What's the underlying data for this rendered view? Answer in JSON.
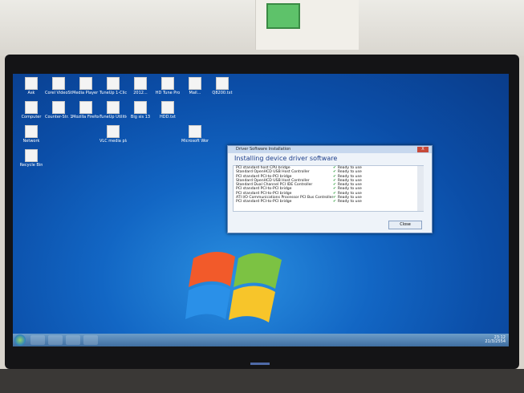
{
  "dialog": {
    "window_title": "Driver Software Installation",
    "close_glyph": "X",
    "heading": "Installing device driver software",
    "close_button": "Close",
    "rows": [
      {
        "device": "PCI standard host CPU bridge",
        "status": "Ready to use"
      },
      {
        "device": "Standard OpenHCD USB Host Controller",
        "status": "Ready to use"
      },
      {
        "device": "PCI standard PCI-to-PCI bridge",
        "status": "Ready to use"
      },
      {
        "device": "Standard OpenHCD USB Host Controller",
        "status": "Ready to use"
      },
      {
        "device": "Standard Dual Channel PCI IDE Controller",
        "status": "Ready to use"
      },
      {
        "device": "PCI standard PCI-to-PCI bridge",
        "status": "Ready to use"
      },
      {
        "device": "PCI standard PCI-to-PCI bridge",
        "status": "Ready to use"
      },
      {
        "device": "ATI I/O Communications Processor PCI Bus Controller",
        "status": "Ready to use"
      },
      {
        "device": "PCI standard PCI-to-PCI bridge",
        "status": "Ready to use"
      }
    ]
  },
  "desktop_icons": [
    {
      "label": "Ask"
    },
    {
      "label": "Corel VideoStudi..."
    },
    {
      "label": "Media Player Classic"
    },
    {
      "label": "TuneUp 1-Click Mai..."
    },
    {
      "label": "2012..."
    },
    {
      "label": "HD Tune Pro"
    },
    {
      "label": "Mail..."
    },
    {
      "label": "Q8200.txt"
    },
    {
      "label": "Computer"
    },
    {
      "label": "Counter-Str. 1.6"
    },
    {
      "label": "Mozilla Firefox"
    },
    {
      "label": "TuneUp Utilities"
    },
    {
      "label": "Big sis 13"
    },
    {
      "label": "HDD.txt"
    },
    {
      "label": "Network"
    },
    {
      "label": "Recycle Bin"
    },
    {
      "label": "VLC media player"
    },
    {
      "label": "Microsoft Word Starter"
    }
  ],
  "taskbar": {
    "clock": "23:12",
    "date": "21/3/2554"
  }
}
